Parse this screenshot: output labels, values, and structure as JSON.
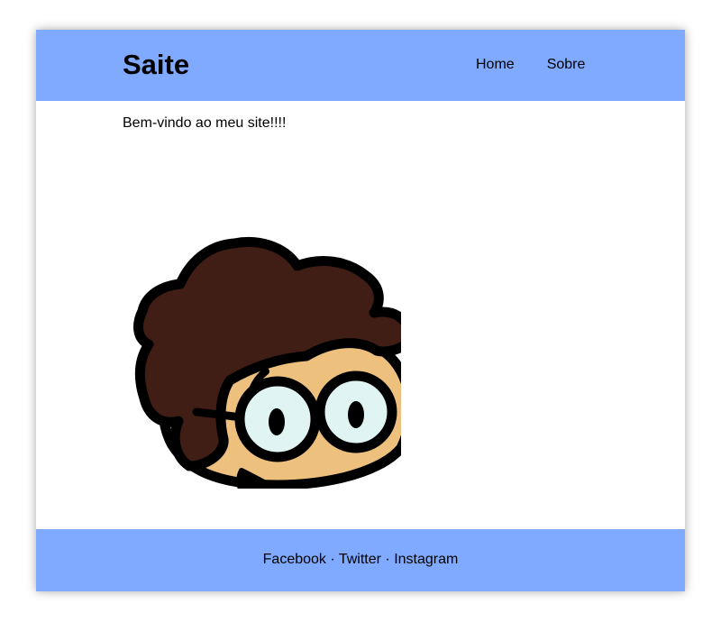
{
  "header": {
    "title": "Saite",
    "nav": [
      "Home",
      "Sobre"
    ],
    "background": "#7faaff"
  },
  "main": {
    "welcome": "Bem-vindo ao meu site!!!!",
    "image": {
      "icon": "cartoon-boy-with-glasses",
      "colors": {
        "hair": "#401e16",
        "skin": "#eec07e",
        "lens": "#dff4f3",
        "outline": "#000000"
      }
    }
  },
  "footer": {
    "links": [
      "Facebook",
      "Twitter",
      "Instagram"
    ],
    "separator": "·",
    "background": "#7faaff"
  }
}
